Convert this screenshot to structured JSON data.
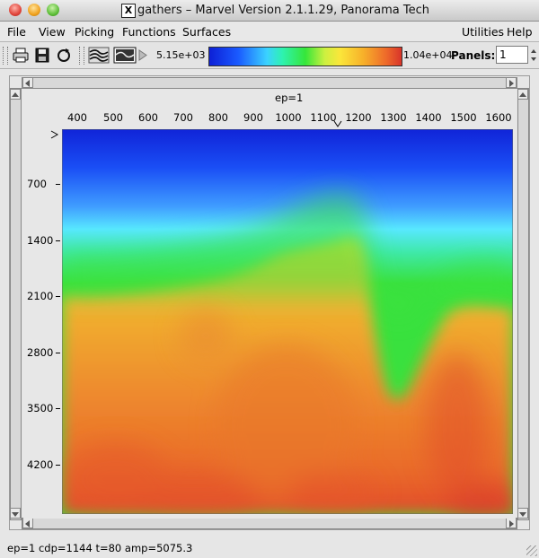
{
  "window": {
    "title": "gathers – Marvel Version 2.1.1.29, Panorama Tech",
    "x_badge": "X"
  },
  "menu": [
    "File",
    "View",
    "Picking",
    "Functions",
    "Surfaces"
  ],
  "menu_right": [
    "Utilities",
    "Help"
  ],
  "toolbar": {
    "icons": [
      "print-icon",
      "save-icon",
      "refresh-icon",
      "wiggle-icon",
      "density-icon"
    ],
    "colorbar_min": "5.15e+03",
    "colorbar_max": "1.04e+04",
    "panels_label": "Panels:",
    "panels_value": "1"
  },
  "plot": {
    "header": "ep=1",
    "x_ticks": [
      "400",
      "500",
      "600",
      "700",
      "800",
      "900",
      "1000",
      "1100",
      "1200",
      "1300",
      "1400",
      "1500",
      "1600"
    ],
    "y_ticks": [
      "700",
      "1400",
      "2100",
      "2800",
      "3500",
      "4200"
    ]
  },
  "status": "ep=1  cdp=1144 t=80 amp=5075.3"
}
